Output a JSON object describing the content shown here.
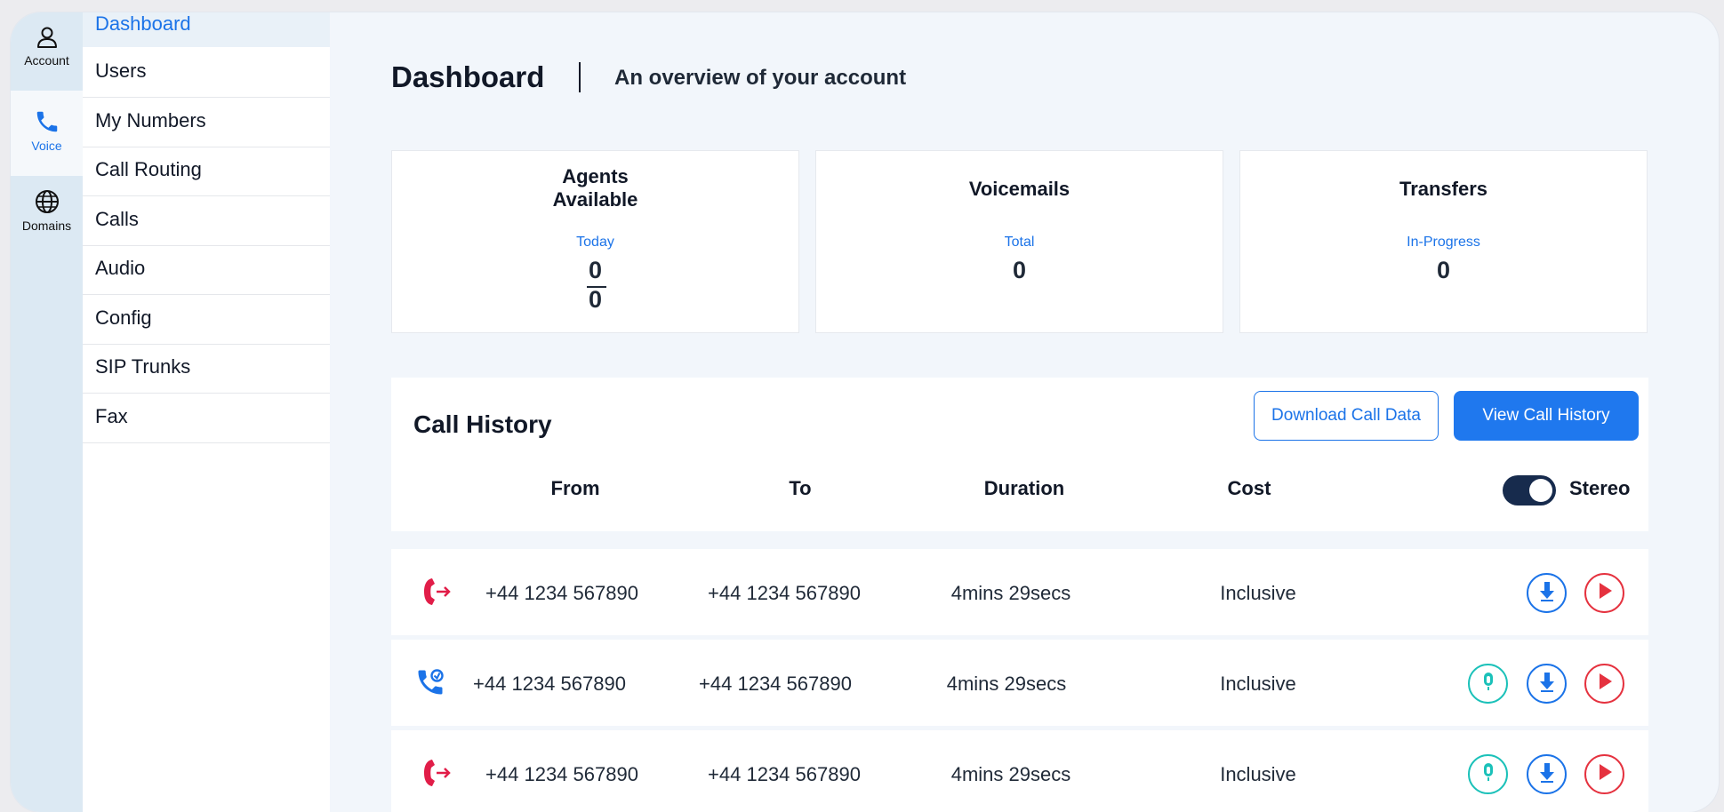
{
  "rail": [
    {
      "label": "Account",
      "icon": "user-icon"
    },
    {
      "label": "Voice",
      "icon": "phone-icon"
    },
    {
      "label": "Domains",
      "icon": "globe-icon"
    }
  ],
  "submenu": {
    "active": "Dashboard",
    "items": [
      "Users",
      "My Numbers",
      "Call Routing",
      "Calls",
      "Audio",
      "Config",
      "SIP Trunks",
      "Fax"
    ]
  },
  "header": {
    "title": "Dashboard",
    "subtitle": "An overview of your account"
  },
  "stats": [
    {
      "title_line1": "Agents",
      "title_line2": "Available",
      "sub": "Today",
      "numerator": "0",
      "denominator": "0"
    },
    {
      "title": "Voicemails",
      "sub": "Total",
      "value": "0"
    },
    {
      "title": "Transfers",
      "sub": "In-Progress",
      "value": "0"
    }
  ],
  "call_history": {
    "title": "Call History",
    "download_label": "Download Call Data",
    "view_label": "View Call History",
    "columns": [
      "From",
      "To",
      "Duration",
      "Cost"
    ],
    "stereo_label": "Stereo",
    "stereo_on": true,
    "rows": [
      {
        "direction": "outbound",
        "from": "+44 1234 567890",
        "to": "+44 1234 567890",
        "duration": "4mins 29secs",
        "cost": "Inclusive",
        "has_recording": false
      },
      {
        "direction": "inbound",
        "from": "+44 1234 567890",
        "to": "+44 1234 567890",
        "duration": "4mins 29secs",
        "cost": "Inclusive",
        "has_recording": true
      },
      {
        "direction": "outbound",
        "from": "+44 1234 567890",
        "to": "+44 1234 567890",
        "duration": "4mins 29secs",
        "cost": "Inclusive",
        "has_recording": true
      }
    ]
  },
  "colors": {
    "accent": "#1b73e8",
    "outbound": "#e11d48",
    "recording": "#1bc1b9",
    "play": "#e5323f",
    "toggle": "#172b4d"
  }
}
